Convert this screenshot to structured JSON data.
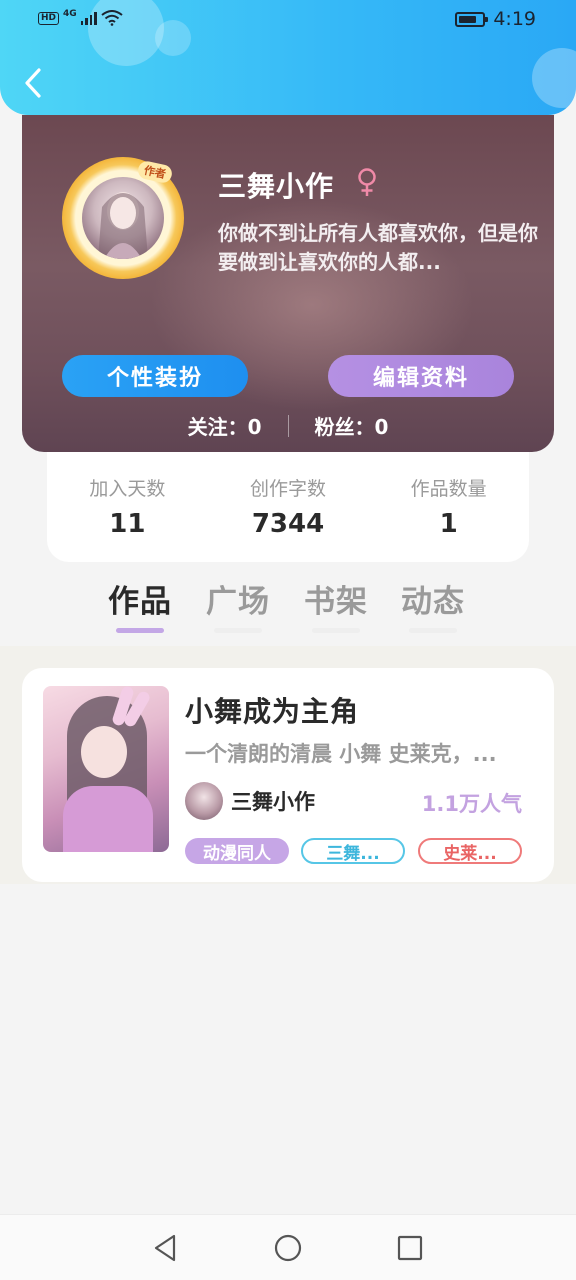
{
  "status_bar": {
    "hd": "HD",
    "network": "4G",
    "time": "4:19"
  },
  "profile": {
    "author_badge": "作者",
    "name": "三舞小作",
    "gender_symbol": "♀",
    "bio": "你做不到让所有人都喜欢你，但是你要做到让喜欢你的人都...",
    "dress_button": "个性装扮",
    "edit_button": "编辑资料",
    "following_label": "关注：",
    "following_count": "0",
    "followers_label": "粉丝：",
    "followers_count": "0"
  },
  "stats": [
    {
      "label": "加入天数",
      "value": "11"
    },
    {
      "label": "创作字数",
      "value": "7344"
    },
    {
      "label": "作品数量",
      "value": "1"
    }
  ],
  "tabs": [
    {
      "label": "作品",
      "active": true
    },
    {
      "label": "广场",
      "active": false
    },
    {
      "label": "书架",
      "active": false
    },
    {
      "label": "动态",
      "active": false
    }
  ],
  "work": {
    "title": "小舞成为主角",
    "description": "一个清朗的清晨 小舞 史莱克，...",
    "author": "三舞小作",
    "popularity": "1.1万人气",
    "tags": [
      "动漫同人",
      "三舞...",
      "史莱..."
    ]
  },
  "colors": {
    "header_gradient_start": "#4fd6f6",
    "header_gradient_end": "#2aa8f5",
    "dress_button": "#2aa2f5",
    "edit_button": "#b590e3",
    "active_tab_indicator": "#c3a7e6",
    "popularity": "#c3a2e0"
  },
  "icons": {
    "back": "chevron-left-icon",
    "gender": "female-icon",
    "nav_back": "triangle-back-icon",
    "nav_home": "circle-home-icon",
    "nav_recent": "square-recent-icon"
  }
}
